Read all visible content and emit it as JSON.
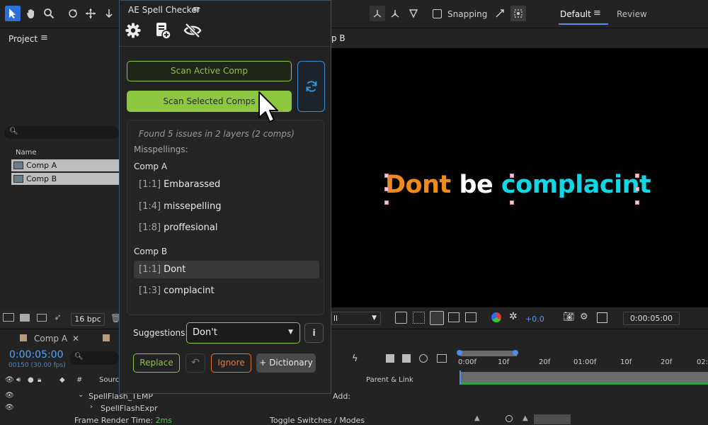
{
  "toolbar": {
    "snapping_label": "Snapping",
    "workspace_default": "Default",
    "workspace_review": "Review"
  },
  "project": {
    "title": "Project",
    "column_name": "Name",
    "items": [
      {
        "label": "Comp A"
      },
      {
        "label": "Comp B"
      }
    ],
    "bpc": "16 bpc"
  },
  "viewer": {
    "tab_label": "p B",
    "words": [
      "Dont",
      "be",
      "complacint"
    ],
    "resolution": "ll",
    "exposure": "+0.0",
    "timecode": "0:00:05:00"
  },
  "timeline": {
    "tab_label": "Comp A",
    "time": "0:00:05:00",
    "fps": "00150 (30.00 fps)",
    "col_source": "Source",
    "col_parent": "Parent & Link",
    "layers": [
      "SpellFlash_TEMP",
      "SpellFlashExpr"
    ],
    "add_label": "Add:",
    "render_time_label": "Frame Render Time:",
    "render_time_value": "2ms",
    "toggle_modes": "Toggle Switches / Modes",
    "ticks": [
      "0:00f",
      "10f",
      "20f",
      "01:00f",
      "10f",
      "20f",
      "02:0"
    ]
  },
  "spell": {
    "title": "AE Spell Checker",
    "scan_active": "Scan Active Comp",
    "scan_selected": "Scan Selected Comps",
    "summary": "Found 5 issues in 2 layers (2 comps)",
    "misspellings_label": "Misspellings:",
    "groups": [
      {
        "name": "Comp A",
        "issues": [
          {
            "loc": "[1:1]",
            "word": "Embarassed"
          },
          {
            "loc": "[1:4]",
            "word": "missepelling"
          },
          {
            "loc": "[1:8]",
            "word": "proffesional"
          }
        ]
      },
      {
        "name": "Comp B",
        "issues": [
          {
            "loc": "[1:1]",
            "word": "Dont"
          },
          {
            "loc": "[1:3]",
            "word": "complacint"
          }
        ]
      }
    ],
    "suggestions_label": "Suggestions:",
    "suggestion_value": "Don't",
    "info_label": "i",
    "replace": "Replace",
    "ignore": "Ignore",
    "add_dictionary": "+ Dictionary"
  },
  "colors": {
    "green": "#8dc63f",
    "orange": "#e8782e",
    "blue": "#3a8fd0",
    "text_orange": "#f08a1a",
    "text_cyan": "#12d6e4"
  }
}
